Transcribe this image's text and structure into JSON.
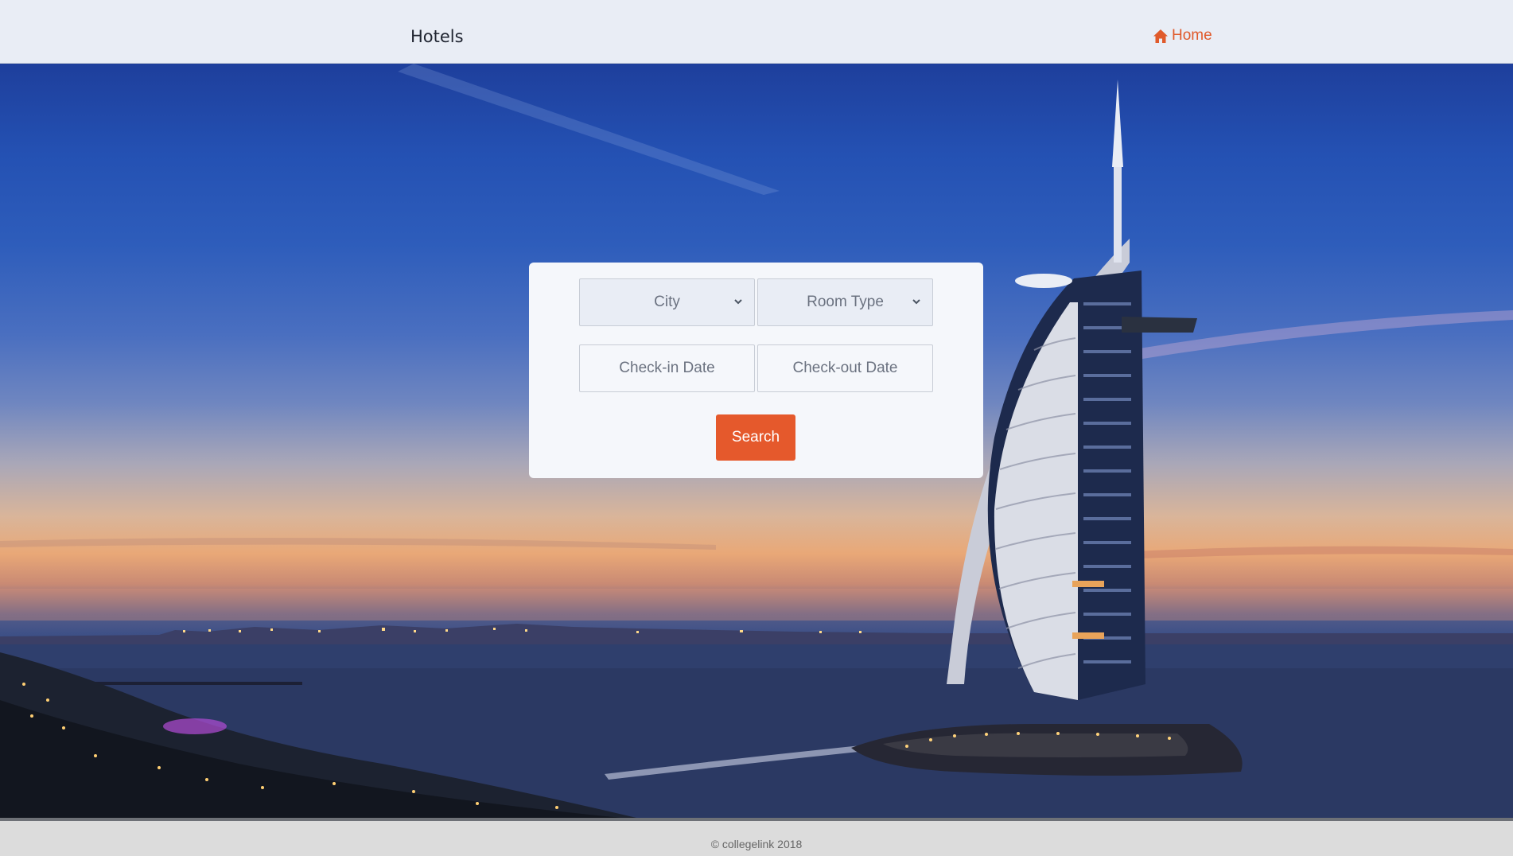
{
  "header": {
    "brand": "Hotels",
    "home_label": "Home",
    "home_icon": "home-icon"
  },
  "search": {
    "city_value": "City",
    "room_type_value": "Room Type",
    "checkin_placeholder": "Check-in Date",
    "checkout_placeholder": "Check-out Date",
    "search_label": "Search"
  },
  "footer": {
    "copyright": "© collegelink 2018"
  },
  "colors": {
    "accent": "#e5592c",
    "header_bg": "#e9edf5",
    "footer_bg": "#dcdcdc"
  }
}
